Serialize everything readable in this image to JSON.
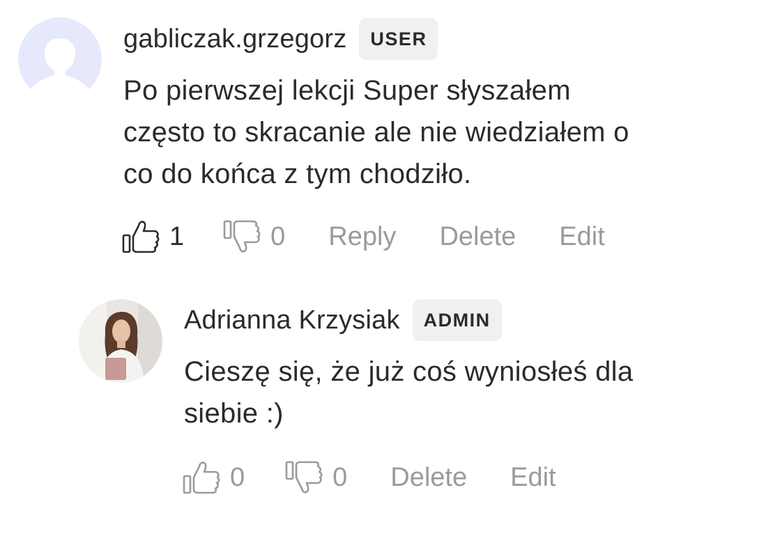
{
  "comments": [
    {
      "username": "gabliczak.grzegorz",
      "role_badge": "USER",
      "lines": [
        "Po pierwszej lekcji Super słyszałem",
        "często to skracanie ale nie wiedziałem o",
        "co do końca z tym chodziło."
      ],
      "likes": "1",
      "dislikes": "0",
      "reply_label": "Reply",
      "delete_label": "Delete",
      "edit_label": "Edit"
    }
  ],
  "replies": [
    {
      "username": "Adrianna Krzysiak",
      "role_badge": "ADMIN",
      "lines": [
        "Cieszę się, że już coś wyniosłeś dla",
        "siebie :)"
      ],
      "likes": "0",
      "dislikes": "0",
      "delete_label": "Delete",
      "edit_label": "Edit"
    }
  ],
  "colors": {
    "text": "#2b2b2b",
    "muted": "#9a9a9a",
    "badge_bg": "#f0f0f0",
    "default_avatar_bg": "#e6e9fb"
  },
  "icons": {
    "default_avatar": "person-silhouette-icon",
    "like": "thumbs-up-icon",
    "dislike": "thumbs-down-icon"
  }
}
